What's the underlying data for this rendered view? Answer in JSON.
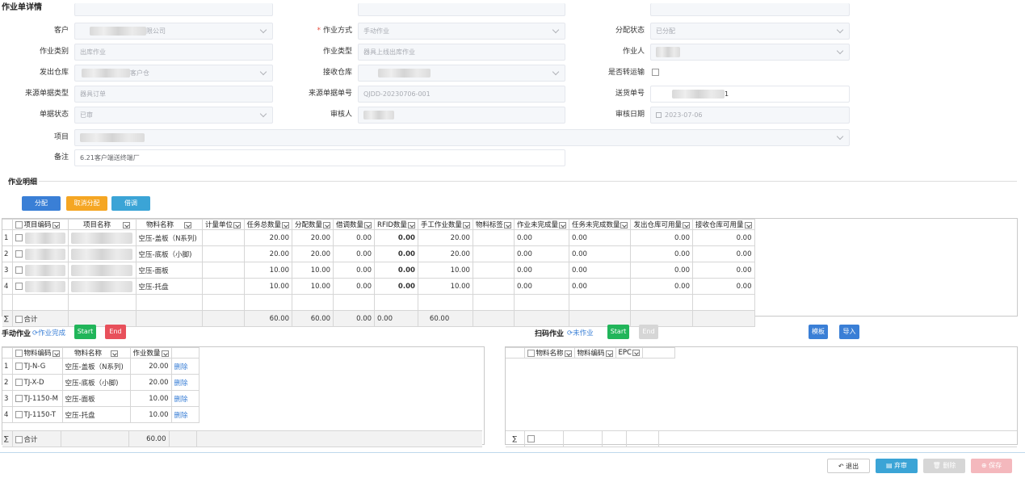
{
  "page_title": "作业单详情",
  "form": {
    "customer": {
      "label": "客户",
      "value": "限公司"
    },
    "work_mode": {
      "label": "作业方式",
      "value": "手动作业",
      "required": true
    },
    "alloc_status": {
      "label": "分配状态",
      "value": "已分配"
    },
    "work_category": {
      "label": "作业类别",
      "value": "出库作业"
    },
    "work_type": {
      "label": "作业类型",
      "value": "器具上线出库作业"
    },
    "worker": {
      "label": "作业人",
      "value": ""
    },
    "from_warehouse": {
      "label": "发出仓库",
      "value": "客户仓"
    },
    "to_warehouse": {
      "label": "接收仓库",
      "value": ""
    },
    "transfer": {
      "label": "是否转运输"
    },
    "source_type": {
      "label": "来源单据类型",
      "value": "器具订单"
    },
    "source_no": {
      "label": "来源单据单号",
      "value": "QJDD-20230706-001"
    },
    "delivery_no": {
      "label": "送货单号",
      "value": "1"
    },
    "doc_status": {
      "label": "单据状态",
      "value": "已审"
    },
    "auditor": {
      "label": "审核人",
      "value": ""
    },
    "audit_date": {
      "label": "审核日期",
      "value": "2023-07-06"
    },
    "project": {
      "label": "项目",
      "value": ""
    },
    "remark": {
      "label": "备注",
      "value": "6.21客户端送终端厂"
    }
  },
  "details": {
    "section_title": "作业明细",
    "buttons": {
      "allocate": "分配",
      "cancel_allocate": "取消分配",
      "borrow": "借调"
    },
    "columns": [
      "项目编码",
      "项目名称",
      "物料名称",
      "计量单位",
      "任务总数量",
      "分配数量",
      "借调数量",
      "RFID数量",
      "手工作业数量",
      "物料标签",
      "作业未完成量",
      "任务未完成数量",
      "发出仓库可用量",
      "接收仓库可用量"
    ],
    "rows": [
      {
        "n": "1",
        "name": "空压-盖板（N系列)",
        "total": "20.00",
        "alloc": "20.00",
        "borrow": "0.00",
        "rfid": "0.00",
        "manual": "20.00",
        "undone": "0.00",
        "task_undone": "0.00",
        "from_avail": "0.00",
        "to_avail": "0.00"
      },
      {
        "n": "2",
        "name": "空压-底板（小脚)",
        "total": "20.00",
        "alloc": "20.00",
        "borrow": "0.00",
        "rfid": "0.00",
        "manual": "20.00",
        "undone": "0.00",
        "task_undone": "0.00",
        "from_avail": "0.00",
        "to_avail": "0.00"
      },
      {
        "n": "3",
        "name": "空压-面板",
        "total": "10.00",
        "alloc": "10.00",
        "borrow": "0.00",
        "rfid": "0.00",
        "manual": "10.00",
        "undone": "0.00",
        "task_undone": "0.00",
        "from_avail": "0.00",
        "to_avail": "0.00"
      },
      {
        "n": "4",
        "name": "空压-托盘",
        "total": "10.00",
        "alloc": "10.00",
        "borrow": "0.00",
        "rfid": "0.00",
        "manual": "10.00",
        "undone": "0.00",
        "task_undone": "0.00",
        "from_avail": "0.00",
        "to_avail": "0.00"
      }
    ],
    "sum": {
      "symbol": "∑",
      "label": "合计",
      "total": "60.00",
      "alloc": "60.00",
      "borrow": "0.00",
      "rfid": "0.00",
      "manual": "60.00"
    }
  },
  "manual": {
    "title": "手动作业",
    "status": "作业完成",
    "start": "Start",
    "end": "End",
    "columns": [
      "物料编码",
      "物料名称",
      "作业数量"
    ],
    "rows": [
      {
        "n": "1",
        "code": "TJ-N-G",
        "name": "空压-盖板（N系列)",
        "qty": "20.00",
        "action": "删除"
      },
      {
        "n": "2",
        "code": "TJ-X-D",
        "name": "空压-底板（小脚)",
        "qty": "20.00",
        "action": "删除"
      },
      {
        "n": "3",
        "code": "TJ-1150-M",
        "name": "空压-面板",
        "qty": "10.00",
        "action": "删除"
      },
      {
        "n": "4",
        "code": "TJ-1150-T",
        "name": "空压-托盘",
        "qty": "10.00",
        "action": "删除"
      }
    ],
    "sum": {
      "symbol": "∑",
      "label": "合计",
      "qty": "60.00"
    }
  },
  "scan": {
    "title": "扫码作业",
    "status": "未作业",
    "start": "Start",
    "end": "End",
    "template": "模板",
    "import": "导入",
    "columns": [
      "物料名称",
      "物料编码",
      "EPC"
    ],
    "sum_symbol": "∑"
  },
  "footer": {
    "exit": "退出",
    "abandon": "弃审",
    "delete": "删除",
    "save": "保存"
  }
}
